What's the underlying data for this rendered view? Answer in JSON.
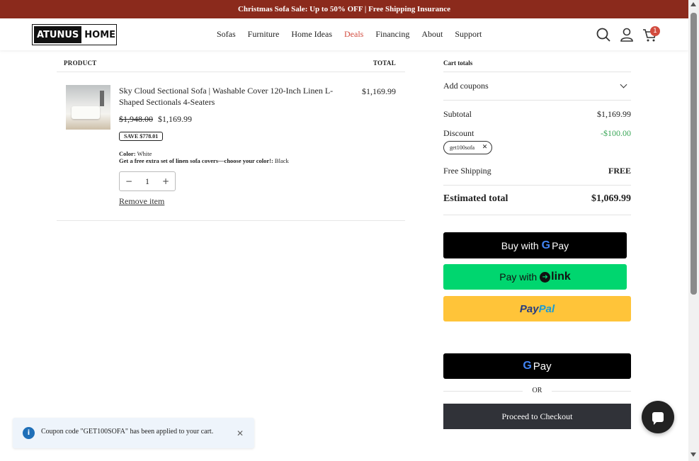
{
  "announcement": "Christmas Sofa Sale: Up to 50% OFF | Free Shipping Insurance",
  "logo": {
    "part1": "ATUNUS",
    "part2": "HOME"
  },
  "nav": [
    "Sofas",
    "Furniture",
    "Home Ideas",
    "Deals",
    "Financing",
    "About",
    "Support"
  ],
  "cart_count": "1",
  "table": {
    "product_header": "PRODUCT",
    "total_header": "TOTAL"
  },
  "item": {
    "title": "Sky Cloud Sectional Sofa | Washable Cover 120-Inch Linen L-Shaped Sectionals 4-Seaters",
    "old_price": "$1,948.00",
    "price": "$1,169.99",
    "total": "$1,169.99",
    "save": "SAVE $778.01",
    "color_label": "Color:",
    "color_value": "White",
    "option_label": "Get a free extra set of linen sofa covers—choose your color!:",
    "option_value": "Black",
    "quantity": "1",
    "remove": "Remove item"
  },
  "totals": {
    "header": "Cart totals",
    "coupons": "Add coupons",
    "subtotal_label": "Subtotal",
    "subtotal": "$1,169.99",
    "discount_label": "Discount",
    "discount": "-$100.00",
    "coupon_chip": "get100sofa",
    "shipping_label": "Free Shipping",
    "shipping": "FREE",
    "estimated_label": "Estimated total",
    "estimated": "$1,069.99"
  },
  "buttons": {
    "gpay_buy_prefix": "Buy with",
    "gpay_pay": "Pay",
    "link_prefix": "Pay with",
    "link_word": "link",
    "paypal_pay": "Pay",
    "paypal_pal": "Pal",
    "or": "OR",
    "checkout": "Proceed to Checkout"
  },
  "toast": "Coupon code \"GET100SOFA\" has been applied to your cart.",
  "colors": {
    "announce_bg": "#8b2a1c",
    "deals": "#d24b3e",
    "discount": "#3aa657",
    "link_green": "#00d66f",
    "paypal_yellow": "#ffc439",
    "checkout_bg": "#303238"
  }
}
